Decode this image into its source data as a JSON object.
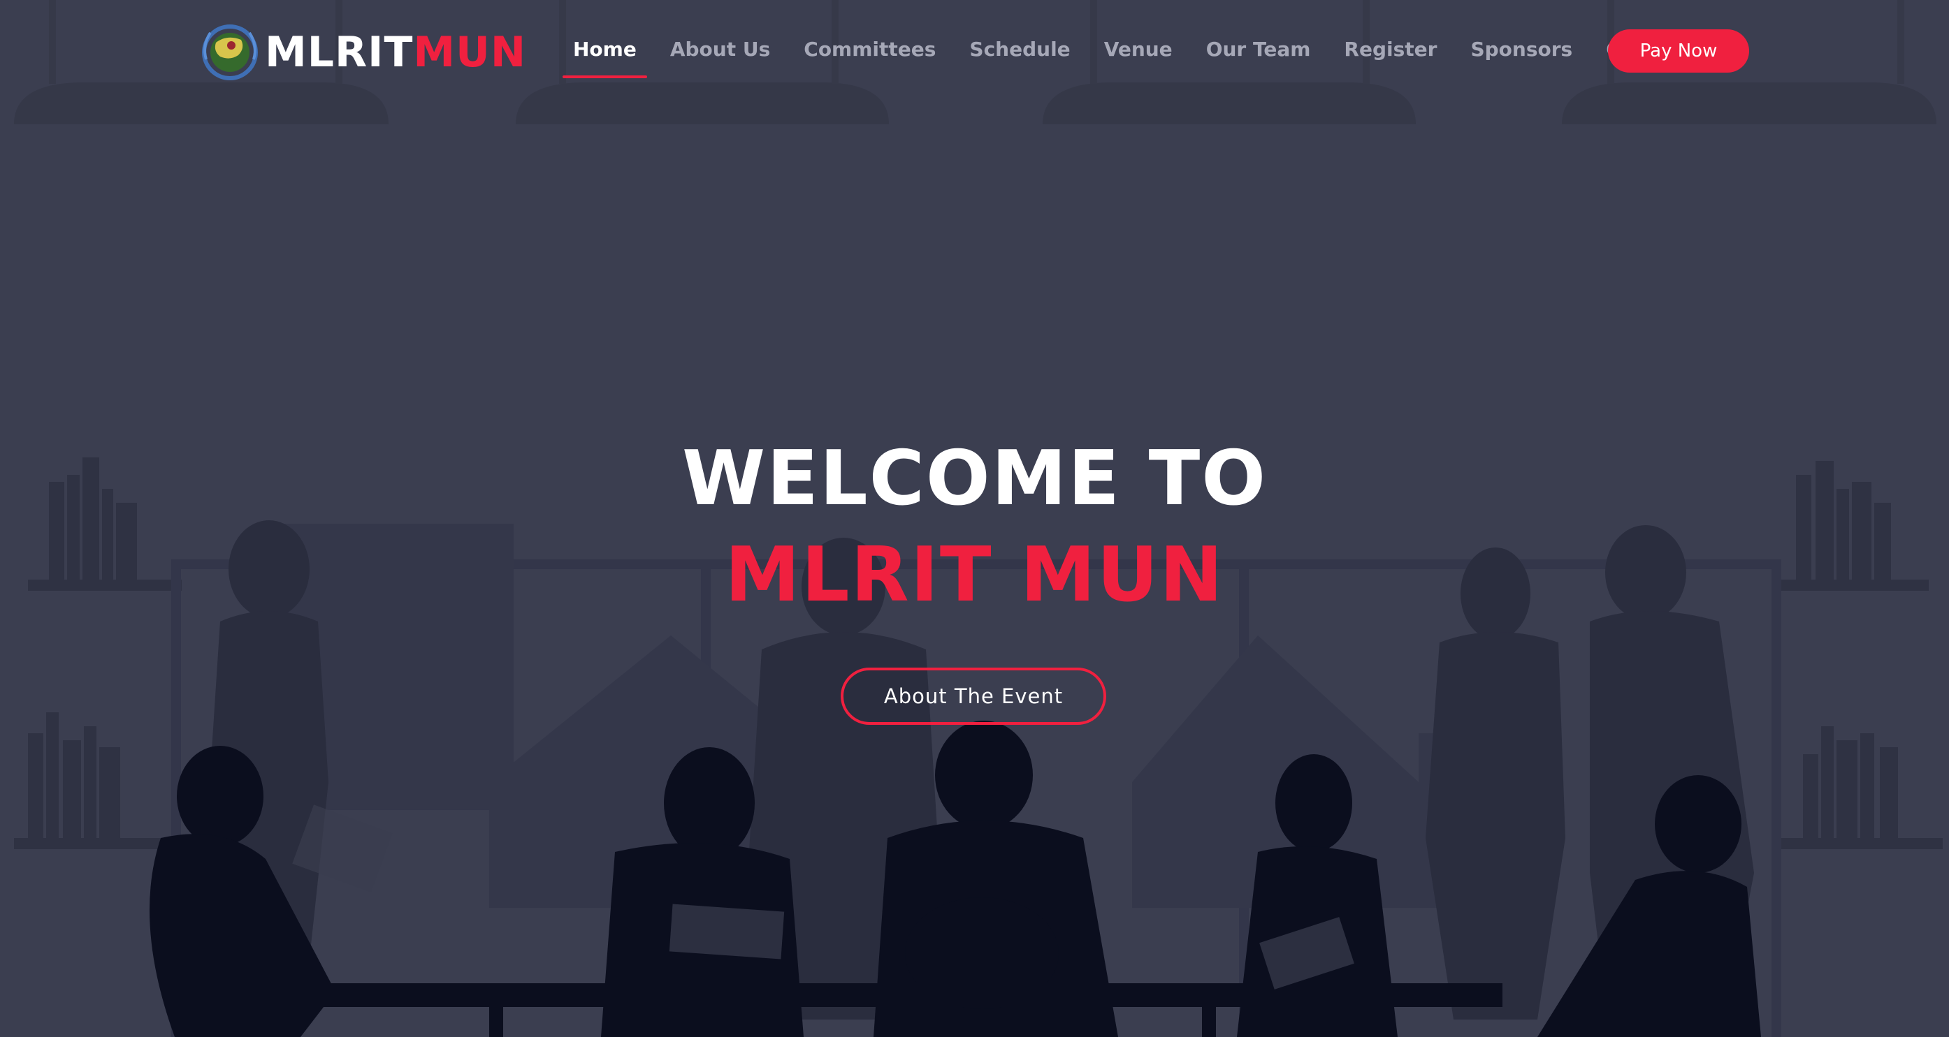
{
  "logo": {
    "text_white": "MLRIT",
    "text_red": "MUN",
    "emblem_icon": "un-emblem-icon"
  },
  "nav": {
    "items": [
      {
        "label": "Home",
        "active": true
      },
      {
        "label": "About Us",
        "active": false
      },
      {
        "label": "Committees",
        "active": false
      },
      {
        "label": "Schedule",
        "active": false
      },
      {
        "label": "Venue",
        "active": false
      },
      {
        "label": "Our Team",
        "active": false
      },
      {
        "label": "Register",
        "active": false
      },
      {
        "label": "Sponsors",
        "active": false
      },
      {
        "label": "Contact",
        "active": false
      }
    ],
    "pay_button": "Pay Now"
  },
  "hero": {
    "line1": "WELCOME TO",
    "line2": "MLRIT MUN",
    "cta": "About The Event",
    "background": "conference-room-silhouettes-illustration"
  },
  "colors": {
    "background": "#3b3e50",
    "accent": "#f0203f",
    "nav_text": "#a6a8b7",
    "nav_active": "#ffffff",
    "silhouette_dark": "#0b0e1e"
  }
}
